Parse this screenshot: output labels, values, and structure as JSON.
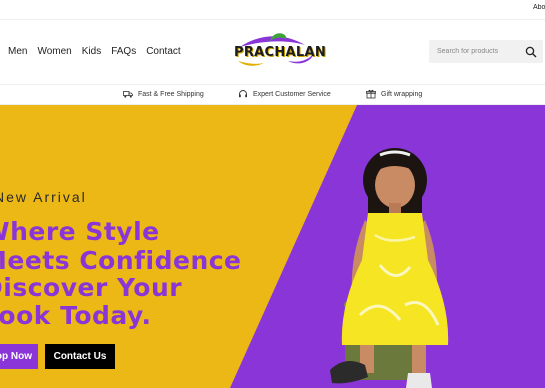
{
  "topbar": {
    "link": "About"
  },
  "nav": {
    "items": [
      "Men",
      "Women",
      "Kids",
      "FAQs",
      "Contact"
    ]
  },
  "logo": {
    "text": "PRACHALAN"
  },
  "search": {
    "placeholder": "Search for products"
  },
  "features": {
    "items": [
      {
        "label": "Fast & Free Shipping",
        "icon": "truck-icon"
      },
      {
        "label": "Expert Customer Service",
        "icon": "headset-icon"
      },
      {
        "label": "Gift wrapping",
        "icon": "gift-icon"
      }
    ]
  },
  "hero": {
    "kicker": "New Arrival",
    "lines": [
      "Where Style",
      "Meets Confidence",
      "Discover Your",
      "Look Today."
    ],
    "shop_button": "Shop Now",
    "contact_button": "Contact Us"
  },
  "colors": {
    "yellow": "#ecb816",
    "purple": "#8a35d8",
    "black": "#000000"
  }
}
